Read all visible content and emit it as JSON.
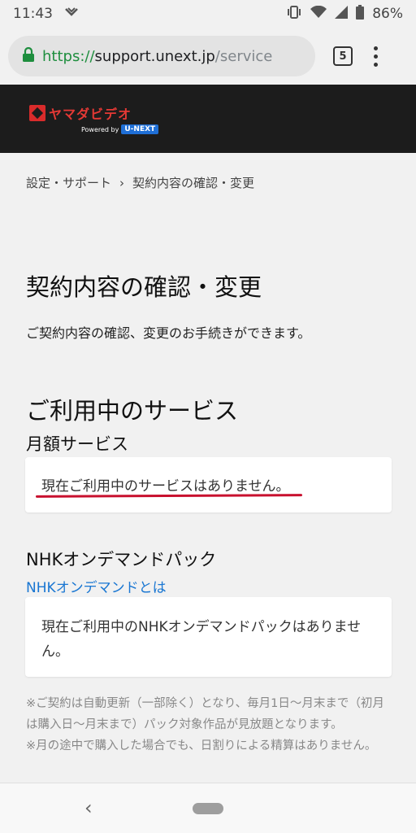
{
  "status_bar": {
    "time": "11:43",
    "battery": "86%"
  },
  "browser": {
    "url_scheme": "https://",
    "url_host": "support.unext.jp",
    "url_path": "/service",
    "tab_count": "5"
  },
  "header": {
    "logo_text": "ヤマダビデオ",
    "logo_powered": "Powered by",
    "logo_badge": "U-NEXT"
  },
  "breadcrumb": {
    "parent": "設定・サポート",
    "separator": "›",
    "current": "契約内容の確認・変更"
  },
  "page": {
    "title": "契約内容の確認・変更",
    "description": "ご契約内容の確認、変更のお手続きができます。"
  },
  "services": {
    "section_title": "ご利用中のサービス",
    "monthly_title": "月額サービス",
    "monthly_empty": "現在ご利用中のサービスはありません。"
  },
  "nhk": {
    "title": "NHKオンデマンドパック",
    "link": "NHKオンデマンドとは",
    "empty": "現在ご利用中のNHKオンデマンドパックはありません。"
  },
  "notes": {
    "note1": "※ご契約は自動更新（一部除く）となり、毎月1日〜月末まで（初月は購入日〜月末まで）パック対象作品が見放題となります。",
    "note2": "※月の途中で購入した場合でも、日割りによる精算はありません。"
  },
  "colors": {
    "accent_link": "#1976d2",
    "underline_red": "#c8102e",
    "header_bg": "#1c1c1c"
  }
}
